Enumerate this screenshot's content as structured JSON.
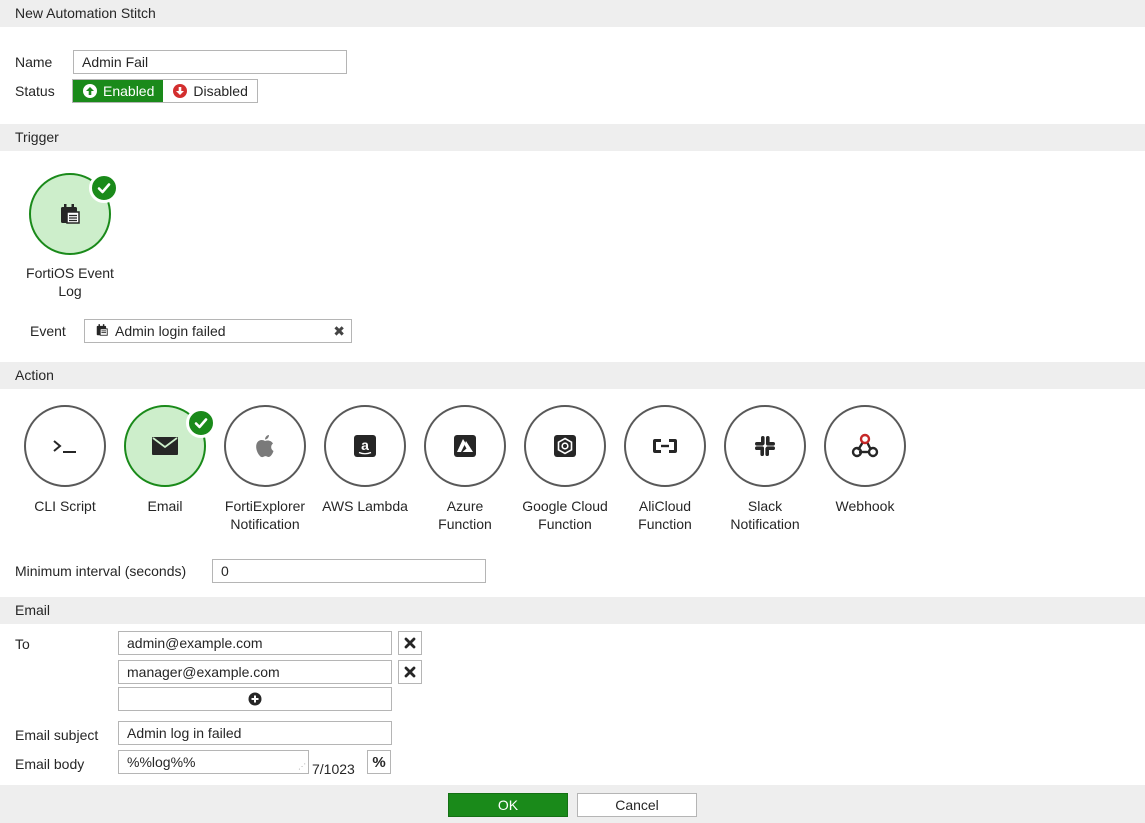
{
  "title": "New Automation Stitch",
  "name": {
    "label": "Name",
    "value": "Admin Fail"
  },
  "status": {
    "label": "Status",
    "enabled": "Enabled",
    "disabled": "Disabled"
  },
  "trigger": {
    "header": "Trigger",
    "selected": {
      "label_line1": "FortiOS Event",
      "label_line2": "Log",
      "icon": "event-log-icon"
    },
    "event_label": "Event",
    "event_value": "Admin login failed"
  },
  "action": {
    "header": "Action",
    "items": [
      {
        "line1": "CLI Script",
        "line2": "",
        "icon": "terminal-icon"
      },
      {
        "line1": "Email",
        "line2": "",
        "icon": "envelope-icon"
      },
      {
        "line1": "FortiExplorer",
        "line2": "Notification",
        "icon": "apple-icon"
      },
      {
        "line1": "AWS Lambda",
        "line2": "",
        "icon": "amazon-icon"
      },
      {
        "line1": "Azure",
        "line2": "Function",
        "icon": "azure-icon"
      },
      {
        "line1": "Google Cloud",
        "line2": "Function",
        "icon": "google-cloud-icon"
      },
      {
        "line1": "AliCloud",
        "line2": "Function",
        "icon": "alicloud-icon"
      },
      {
        "line1": "Slack",
        "line2": "Notification",
        "icon": "slack-icon"
      },
      {
        "line1": "Webhook",
        "line2": "",
        "icon": "webhook-icon"
      }
    ],
    "min_interval_label": "Minimum interval (seconds)",
    "min_interval_value": "0"
  },
  "email": {
    "header": "Email",
    "to_label": "To",
    "recipients": [
      "admin@example.com",
      "manager@example.com"
    ],
    "subject_label": "Email subject",
    "subject_value": "Admin log in failed",
    "body_label": "Email body",
    "body_value": "%%log%%",
    "body_count": "7/1023",
    "percent_label": "%"
  },
  "footer": {
    "ok": "OK",
    "cancel": "Cancel"
  },
  "colors": {
    "accent": "#1a8a1a",
    "selected_fill": "#cdeecb",
    "header_bg": "#eeeeee"
  }
}
